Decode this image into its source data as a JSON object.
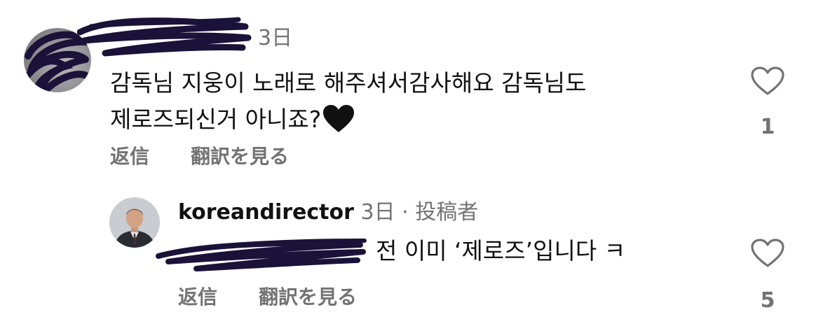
{
  "comment1": {
    "time": "3日",
    "text": "감독님 지웅이 노래로 해주셔서감사해요 감독님도\n제로즈되신거 아니죠?",
    "emoji": "black-heart-emoji",
    "reply_label": "返信",
    "translate_label": "翻訳を見る",
    "like_count": "1"
  },
  "comment2": {
    "username": "koreandirector",
    "time": "3日",
    "separator": "·",
    "author_badge": "投稿者",
    "text": "전 이미 ‘제로즈’입니다 ㅋ",
    "reply_label": "返信",
    "translate_label": "翻訳を見る",
    "like_count": "5"
  },
  "colors": {
    "text": "#111111",
    "secondary": "#737373",
    "mention": "#0095f6",
    "scribble": "#1a1238"
  },
  "icons": [
    "heart-outline-icon",
    "black-heart-emoji"
  ]
}
